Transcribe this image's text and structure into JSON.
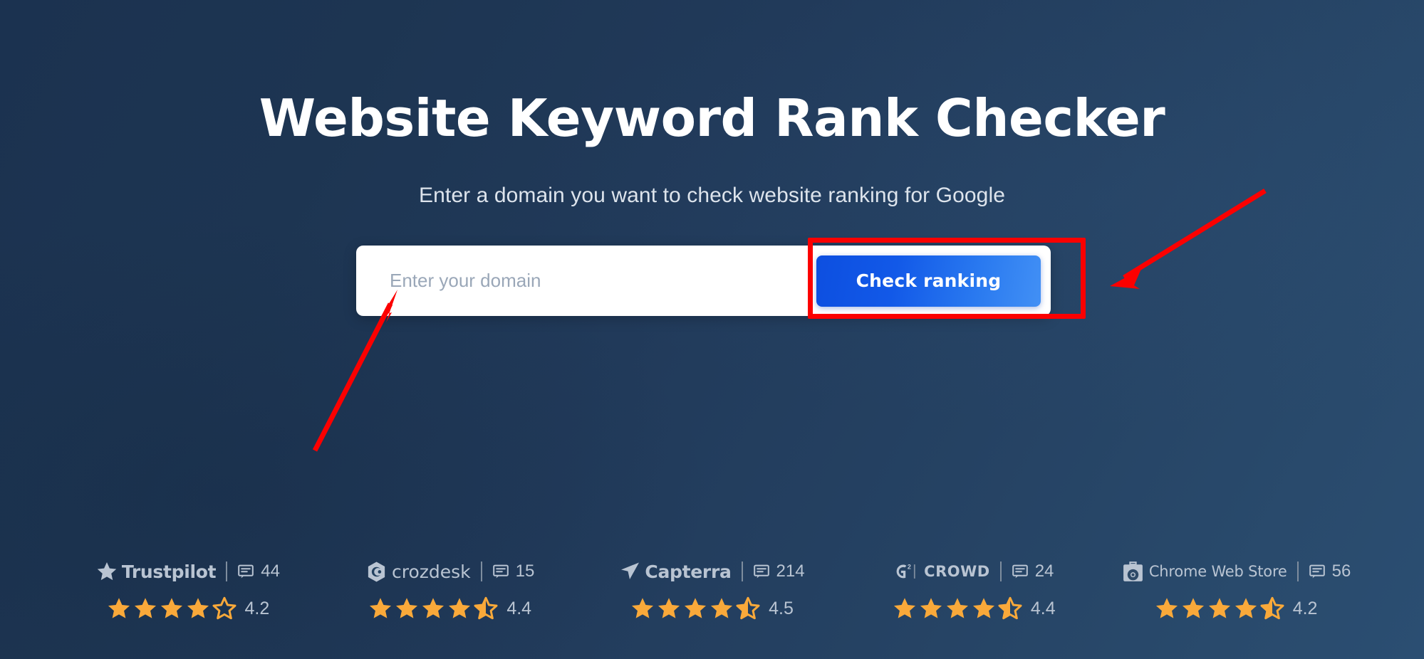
{
  "hero": {
    "title": "Website Keyword Rank Checker",
    "subtitle": "Enter a domain you want to check website ranking for Google"
  },
  "search": {
    "input_value": "",
    "placeholder": "Enter your domain",
    "submit_label": "Check ranking"
  },
  "colors": {
    "background_dark": "#1b3250",
    "background_light": "#2b4e72",
    "button_gradient_start": "#0d4fe0",
    "button_gradient_end": "#4290f5",
    "annotation_red": "#fc0000",
    "star_filled": "#f9a93a",
    "badge_text": "#b9c4d2"
  },
  "annotations": {
    "highlight_target": "check-ranking-button",
    "arrow_1_target": "check-ranking-button",
    "arrow_2_target": "domain-input"
  },
  "trust_badges": [
    {
      "id": "trustpilot",
      "name": "Trustpilot",
      "icon": "star-icon",
      "reviews_icon": "comment-icon",
      "reviews": "44",
      "rating": "4.2",
      "stars_full": 4,
      "stars_half": 0,
      "stars_empty": 1
    },
    {
      "id": "crozdesk",
      "name": "crozdesk",
      "icon": "crozdesk-hexagon-icon",
      "reviews_icon": "comment-icon",
      "reviews": "15",
      "rating": "4.4",
      "stars_full": 4,
      "stars_half": 1,
      "stars_empty": 0
    },
    {
      "id": "capterra",
      "name": "Capterra",
      "icon": "capterra-arrow-icon",
      "reviews_icon": "comment-icon",
      "reviews": "214",
      "rating": "4.5",
      "stars_full": 4,
      "stars_half": 1,
      "stars_empty": 0
    },
    {
      "id": "g2crowd",
      "name": "CROWD",
      "icon": "g2-logo-icon",
      "reviews_icon": "comment-icon",
      "reviews": "24",
      "rating": "4.4",
      "stars_full": 4,
      "stars_half": 1,
      "stars_empty": 0
    },
    {
      "id": "chrome-web-store",
      "name": "Chrome Web Store",
      "icon": "chrome-web-store-icon",
      "reviews_icon": "comment-icon",
      "reviews": "56",
      "rating": "4.2",
      "stars_full": 4,
      "stars_half": 1,
      "stars_empty": 0
    }
  ]
}
